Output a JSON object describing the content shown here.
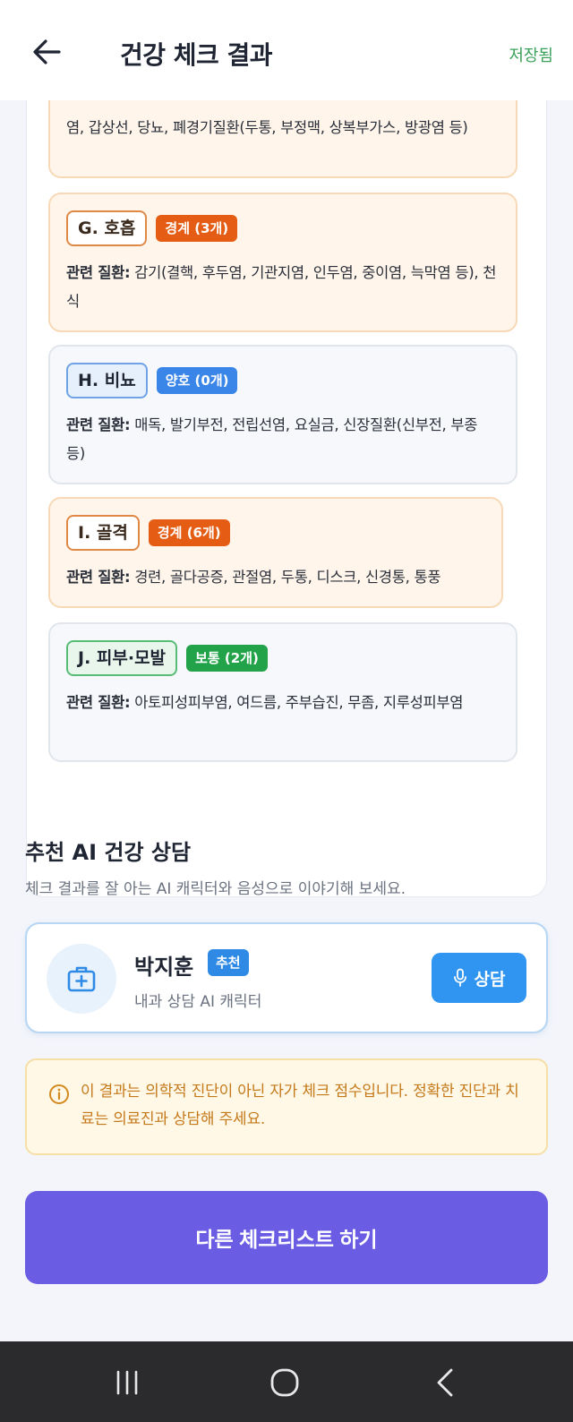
{
  "header": {
    "title": "건강 체크 결과",
    "saved_label": "저장됨"
  },
  "groups": [
    {
      "tag": "",
      "status": "",
      "disease_label": "",
      "diseases": "염, 갑상선, 당뇨, 폐경기질환(두통, 부정맥, 상복부가스, 방광염 등)"
    },
    {
      "tag": "G. 호흡",
      "status": "경계 (3개)",
      "disease_label": "관련 질환:",
      "diseases": "감기(결핵, 후두염, 기관지염, 인두염, 중이염, 늑막염 등), 천식"
    },
    {
      "tag": "H. 비뇨",
      "status": "양호 (0개)",
      "disease_label": "관련 질환:",
      "diseases": "매독, 발기부전, 전립선염, 요실금, 신장질환(신부전, 부종 등)"
    },
    {
      "tag": "I. 골격",
      "status": "경계 (6개)",
      "disease_label": "관련 질환:",
      "diseases": "경련, 골다공증, 관절염, 두통, 디스크, 신경통, 통풍"
    },
    {
      "tag": "J. 피부·모발",
      "status": "보통 (2개)",
      "disease_label": "관련 질환:",
      "diseases": "아토피성피부염, 여드름, 주부습진, 무좀, 지루성피부염"
    }
  ],
  "recommendation": {
    "title": "추천 AI 건강 상담",
    "subtitle": "체크 결과를 잘 아는 AI 캐릭터와 음성으로 이야기해 보세요.",
    "character": {
      "name": "박지훈",
      "badge": "추천",
      "description": "내과 상담 AI 캐릭터",
      "button_label": "상담",
      "avatar_icon": "medical-kit-icon",
      "button_icon": "microphone-icon"
    }
  },
  "notice": {
    "icon": "info-icon",
    "text": "이 결과는 의학적 진단이 아닌 자가 체크 점수입니다. 정확한 진단과 치료는 의료진과 상담해 주세요."
  },
  "cta": {
    "label": "다른 체크리스트 하기"
  },
  "colors": {
    "warning": "#e55d14",
    "good": "#3a86e8",
    "normal": "#23a349",
    "accent": "#6a5ce3",
    "consult": "#2f95f0"
  }
}
